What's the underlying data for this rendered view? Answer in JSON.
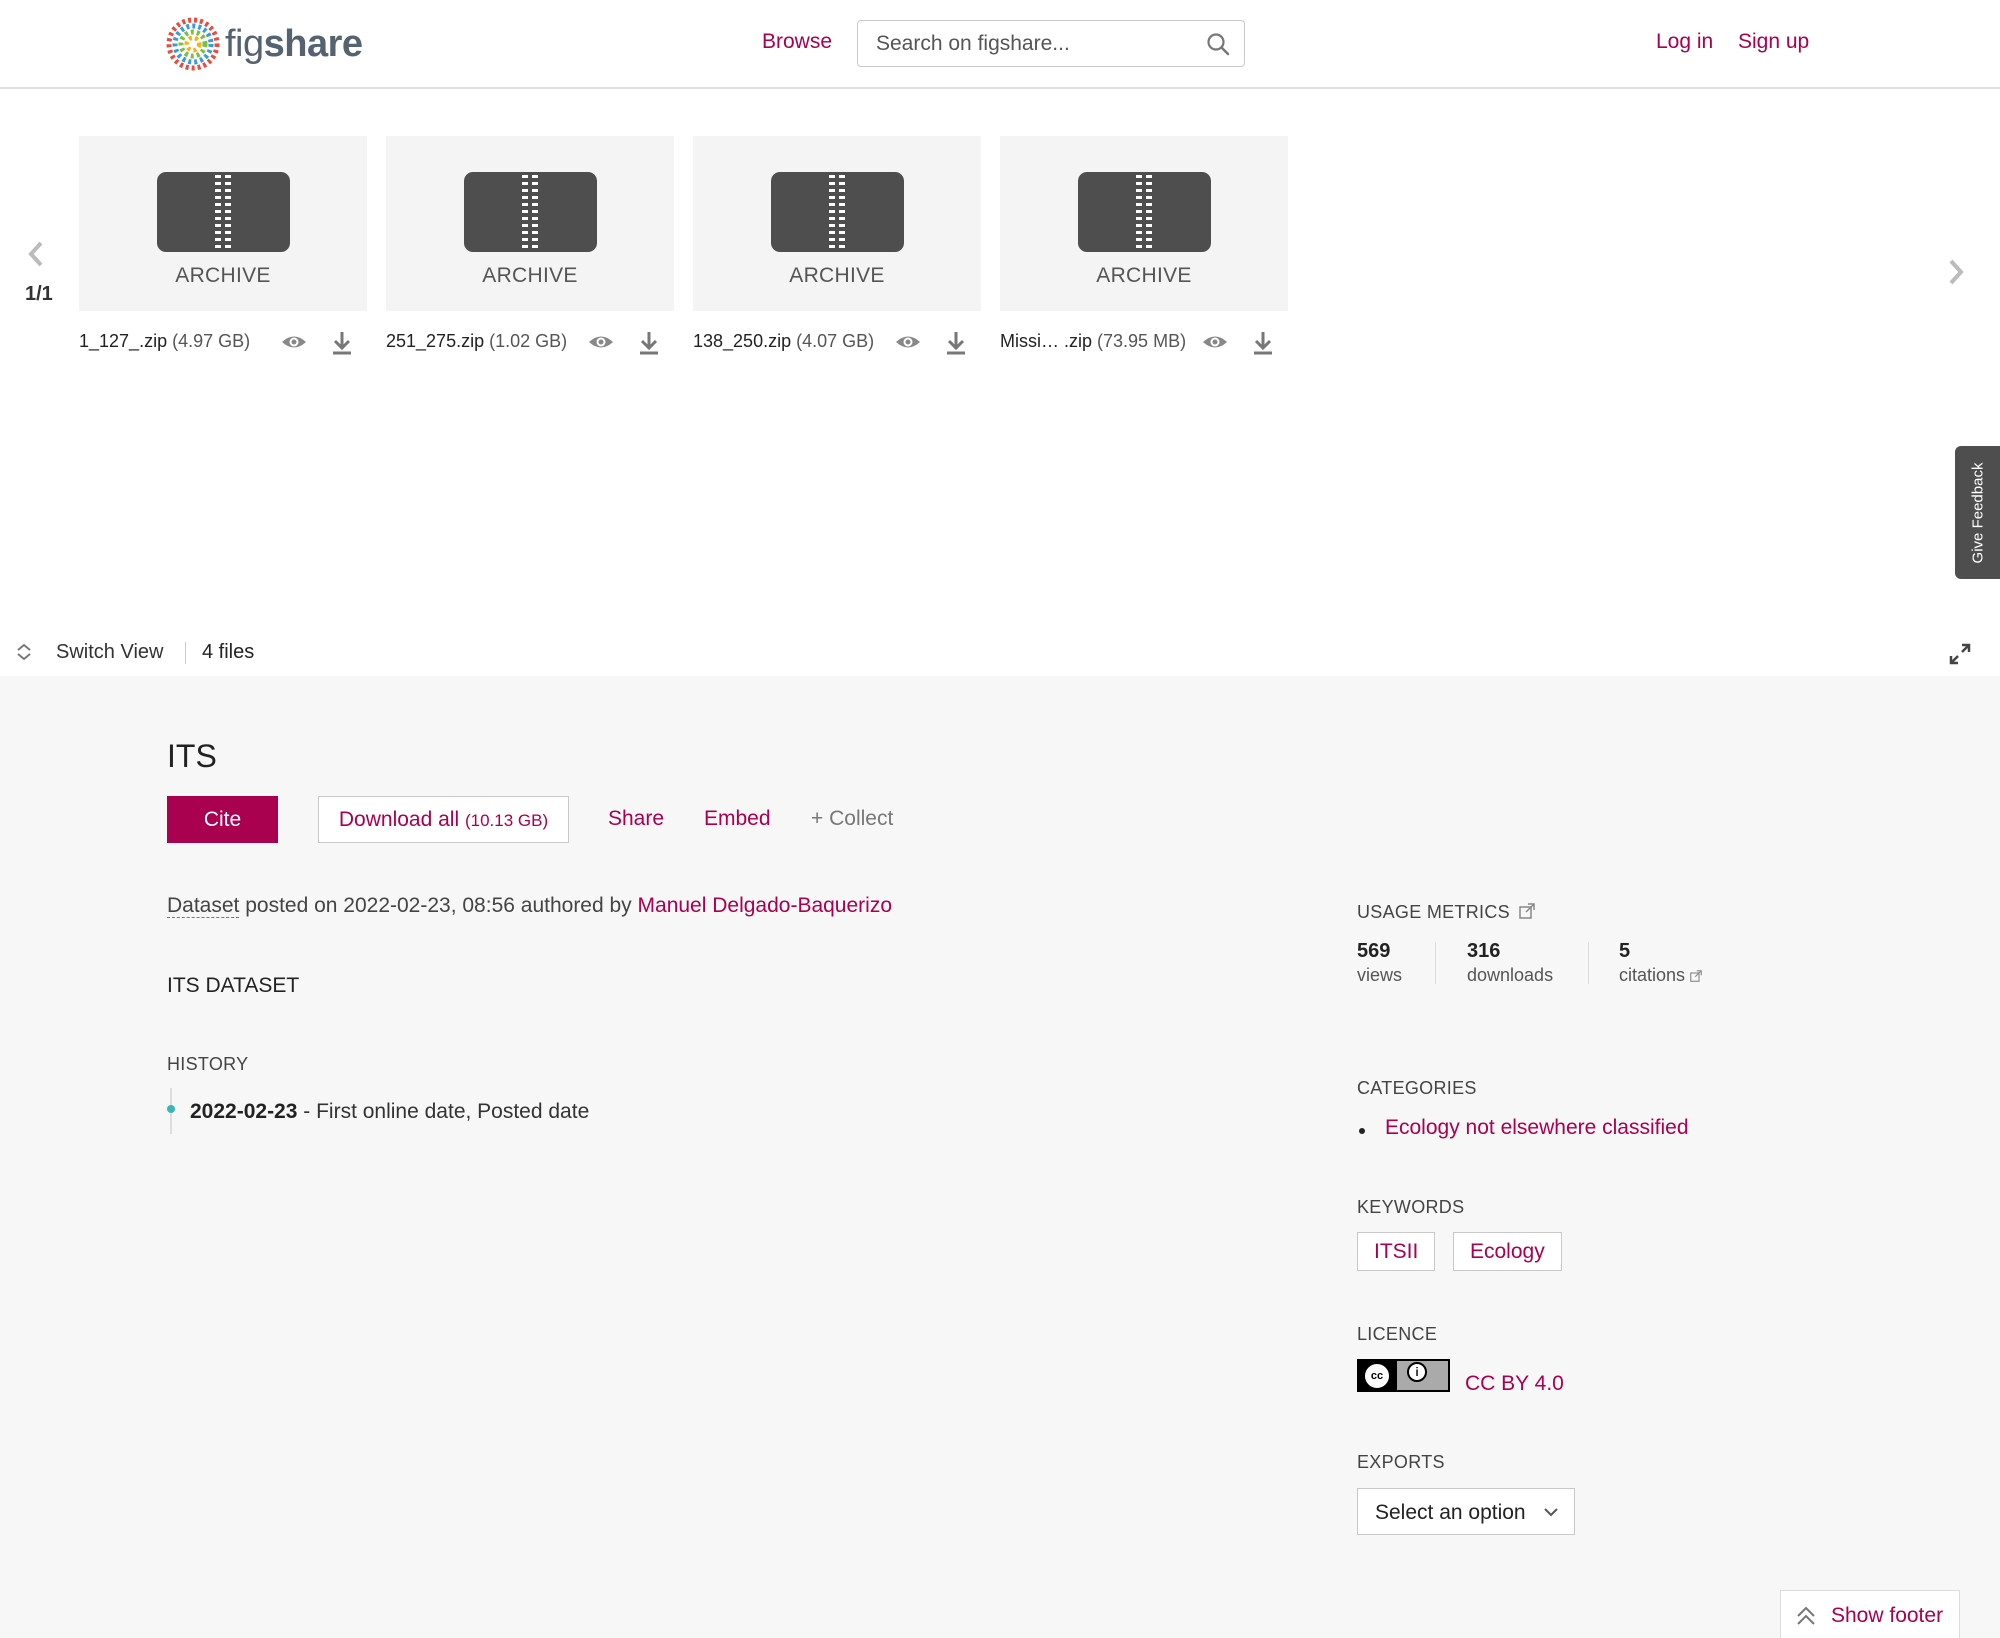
{
  "header": {
    "browse": "Browse",
    "search_placeholder": "Search on figshare...",
    "login": "Log in",
    "signup": "Sign up",
    "logo_fig": "fig",
    "logo_share": "share"
  },
  "viewer": {
    "page": "1/1",
    "files": [
      {
        "type_label": "ARCHIVE",
        "name": "1_127_.zip",
        "size": "(4.97 GB)"
      },
      {
        "type_label": "ARCHIVE",
        "name": "251_275.zip",
        "size": "(1.02 GB)"
      },
      {
        "type_label": "ARCHIVE",
        "name": "138_250.zip",
        "size": "(4.07 GB)"
      },
      {
        "type_label": "ARCHIVE",
        "name": "Missi… .zip",
        "size": "(73.95 MB)"
      }
    ],
    "switch_view": "Switch View",
    "file_count": "4 files",
    "feedback": "Give Feedback"
  },
  "item": {
    "title": "ITS",
    "cite": "Cite",
    "download_all": "Download all",
    "download_size": "(10.13 GB)",
    "share": "Share",
    "embed": "Embed",
    "collect": "+ Collect",
    "type": "Dataset",
    "posted_text": " posted on 2022-02-23, 08:56 authored by ",
    "author": "Manuel Delgado-Baquerizo",
    "description": "ITS DATASET",
    "history_heading": "HISTORY",
    "history": [
      {
        "date": "2022-02-23",
        "text": " - First online date, Posted date"
      }
    ]
  },
  "sidebar": {
    "usage_heading": "USAGE METRICS",
    "metrics": [
      {
        "value": "569",
        "label": "views"
      },
      {
        "value": "316",
        "label": "downloads"
      },
      {
        "value": "5",
        "label": "citations"
      }
    ],
    "categories_heading": "CATEGORIES",
    "categories": [
      "Ecology not elsewhere classified"
    ],
    "keywords_heading": "KEYWORDS",
    "keywords": [
      "ITSII",
      "Ecology"
    ],
    "licence_heading": "LICENCE",
    "licence": "CC BY 4.0",
    "exports_heading": "EXPORTS",
    "exports_select": "Select an option"
  },
  "footer_toggle": "Show footer",
  "colors": {
    "brand": "#a9004f",
    "dark_tile": "#4e4e4e",
    "accent_dot": "#3cb5b5"
  }
}
